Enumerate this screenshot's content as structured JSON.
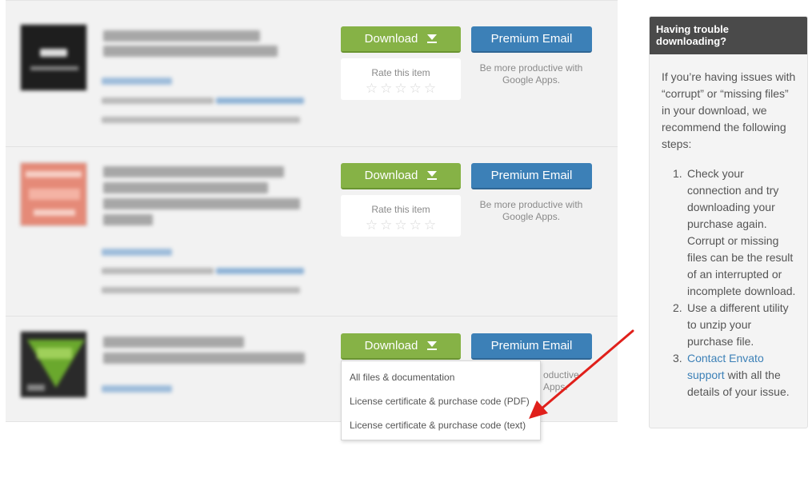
{
  "items": [
    {
      "download_label": "Download",
      "premium_label": "Premium Email",
      "rate_label": "Rate this item",
      "productive_text": "Be more productive with Google Apps.",
      "stars": [
        "☆",
        "☆",
        "☆",
        "☆",
        "☆"
      ]
    },
    {
      "download_label": "Download",
      "premium_label": "Premium Email",
      "rate_label": "Rate this item",
      "productive_text": "Be more productive with Google Apps.",
      "stars": [
        "☆",
        "☆",
        "☆",
        "☆",
        "☆"
      ]
    },
    {
      "download_label": "Download",
      "premium_label": "Premium Email",
      "productive_text": "oductive Apps."
    }
  ],
  "dropdown": {
    "options": [
      "All files & documentation",
      "License certificate & purchase code (PDF)",
      "License certificate & purchase code (text)"
    ]
  },
  "sidebar": {
    "title": "Having trouble downloading?",
    "intro": "If you’re having issues with “corrupt” or “missing files” in your download, we recommend the following steps:",
    "steps": [
      {
        "num": "1.",
        "text": "Check your connection and try downloading your purchase again. Corrupt or missing files can be the result of an interrupted or incomplete download."
      },
      {
        "num": "2.",
        "text": "Use a different utility to unzip your purchase file."
      },
      {
        "num": "3.",
        "link": "Contact Envato support",
        "text": " with all the details of your issue."
      }
    ]
  },
  "colors": {
    "download_green": "#86b246",
    "premium_blue": "#3c80b7",
    "sidebar_header": "#4a4a4a",
    "annotation_arrow": "#e0201b"
  },
  "icons": {
    "download_caret": "download-arrow-icon",
    "star": "star-icon",
    "annotation": "red-arrow-annotation"
  }
}
